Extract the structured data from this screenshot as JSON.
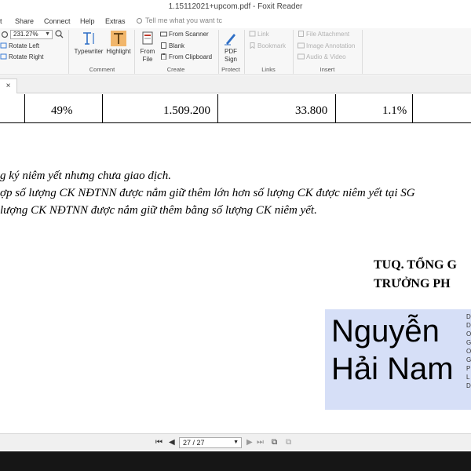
{
  "window": {
    "title": "1.15112021+upcom.pdf - Foxit Reader"
  },
  "menu": {
    "items": [
      "t",
      "Share",
      "Connect",
      "Help",
      "Extras"
    ],
    "tell_me": "Tell me what you want tc"
  },
  "ribbon": {
    "zoom_value": "231.27%",
    "rotate_left": "Rotate Left",
    "rotate_right": "Rotate Right",
    "typewriter": "Typewriter",
    "highlight": "Highlight",
    "comment_group": "Comment",
    "from_file_1": "From",
    "from_file_2": "File",
    "from_scanner": "From Scanner",
    "blank": "Blank",
    "from_clipboard": "From Clipboard",
    "create_group": "Create",
    "pdf_sign_1": "PDF",
    "pdf_sign_2": "Sign",
    "protect_group": "Protect",
    "link": "Link",
    "bookmark": "Bookmark",
    "links_group": "Links",
    "file_attachment": "File Attachment",
    "image_annotation": "Image Annotation",
    "audio_video": "Audio & Video",
    "insert_group": "Insert"
  },
  "tab": {
    "close": "×"
  },
  "document": {
    "row": [
      "49%",
      "1.509.200",
      "33.800",
      "1.1%"
    ],
    "notes": [
      "g ký niêm yết nhưng chưa giao dịch.",
      "ợp số lượng CK NĐTNN được nắm giữ thêm lớn hơn số lượng CK được niêm yết tại SG",
      "lượng CK NĐTNN được nắm giữ thêm bằng số lượng CK niêm yết."
    ],
    "sig_title_1": "TUQ. TỔNG G",
    "sig_title_2": "TRƯỞNG PH",
    "signature_name_1": "Nguyễn",
    "signature_name_2": "Hải Nam",
    "signature_side": [
      "D",
      "D",
      "O",
      "G",
      "O",
      "G",
      "P",
      "L",
      "D"
    ]
  },
  "nav": {
    "page": "27 / 27"
  }
}
